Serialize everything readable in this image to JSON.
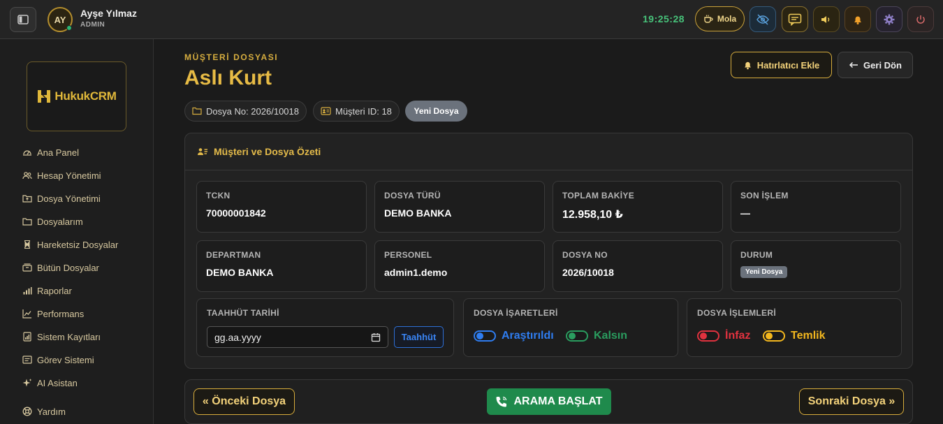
{
  "topbar": {
    "user_initials": "AY",
    "user_name": "Ayşe Yılmaz",
    "user_role": "ADMIN",
    "clock": "19:25:28",
    "break_label": "Mola"
  },
  "sidebar": {
    "logo_text": "HukukCRM",
    "items": [
      {
        "label": "Ana Panel",
        "icon": "dashboard-icon"
      },
      {
        "label": "Hesap Yönetimi",
        "icon": "users-icon"
      },
      {
        "label": "Dosya Yönetimi",
        "icon": "folder-upload-icon"
      },
      {
        "label": "Dosyalarım",
        "icon": "folder-icon"
      },
      {
        "label": "Hareketsiz Dosyalar",
        "icon": "hourglass-icon"
      },
      {
        "label": "Bütün Dosyalar",
        "icon": "archive-icon"
      },
      {
        "label": "Raporlar",
        "icon": "bar-chart-icon"
      },
      {
        "label": "Performans",
        "icon": "line-chart-icon"
      },
      {
        "label": "Sistem Kayıtları",
        "icon": "log-icon"
      },
      {
        "label": "Görev Sistemi",
        "icon": "tasks-icon"
      },
      {
        "label": "AI Asistan",
        "icon": "sparkle-icon"
      },
      {
        "label": "Yardım",
        "icon": "help-icon"
      }
    ]
  },
  "header": {
    "crumb": "MÜŞTERİ DOSYASI",
    "title": "Aslı Kurt",
    "reminder_button": "Hatırlatıcı Ekle",
    "back_button": "Geri Dön",
    "file_no_chip": "Dosya No: 2026/10018",
    "customer_id_chip": "Müşteri ID: 18",
    "status_chip": "Yeni Dosya"
  },
  "summary": {
    "title": "Müşteri ve Dosya Özeti",
    "cards": [
      {
        "label": "TCKN",
        "value": "70000001842"
      },
      {
        "label": "DOSYA TÜRÜ",
        "value": "DEMO BANKA"
      },
      {
        "label": "TOPLAM BAKİYE",
        "value": "12.958,10 ₺"
      },
      {
        "label": "SON İŞLEM",
        "value": "—"
      },
      {
        "label": "DEPARTMAN",
        "value": "DEMO BANKA"
      },
      {
        "label": "PERSONEL",
        "value": "admin1.demo"
      },
      {
        "label": "DOSYA NO",
        "value": "2026/10018"
      },
      {
        "label": "DURUM",
        "value": "Yeni Dosya"
      }
    ],
    "commitment": {
      "label": "TAAHHÜT TARİHİ",
      "date_placeholder": "gg.aa.yyyy",
      "button": "Taahhüt"
    },
    "flags": {
      "label": "DOSYA İŞARETLERİ",
      "researched": "Araştırıldı",
      "stay": "Kalsın"
    },
    "actions": {
      "label": "DOSYA İŞLEMLERİ",
      "execution": "İnfaz",
      "assignment": "Temlik"
    }
  },
  "footer": {
    "prev": "« Önceki Dosya",
    "call": "ARAMA BAŞLAT",
    "next": "Sonraki Dosya »"
  },
  "colors": {
    "accent_gold": "#e7bb45",
    "clock_green": "#47c27a",
    "blue": "#2f7df0",
    "green": "#2a9d5f",
    "red": "#e0323f",
    "yellow": "#f3b71e"
  }
}
